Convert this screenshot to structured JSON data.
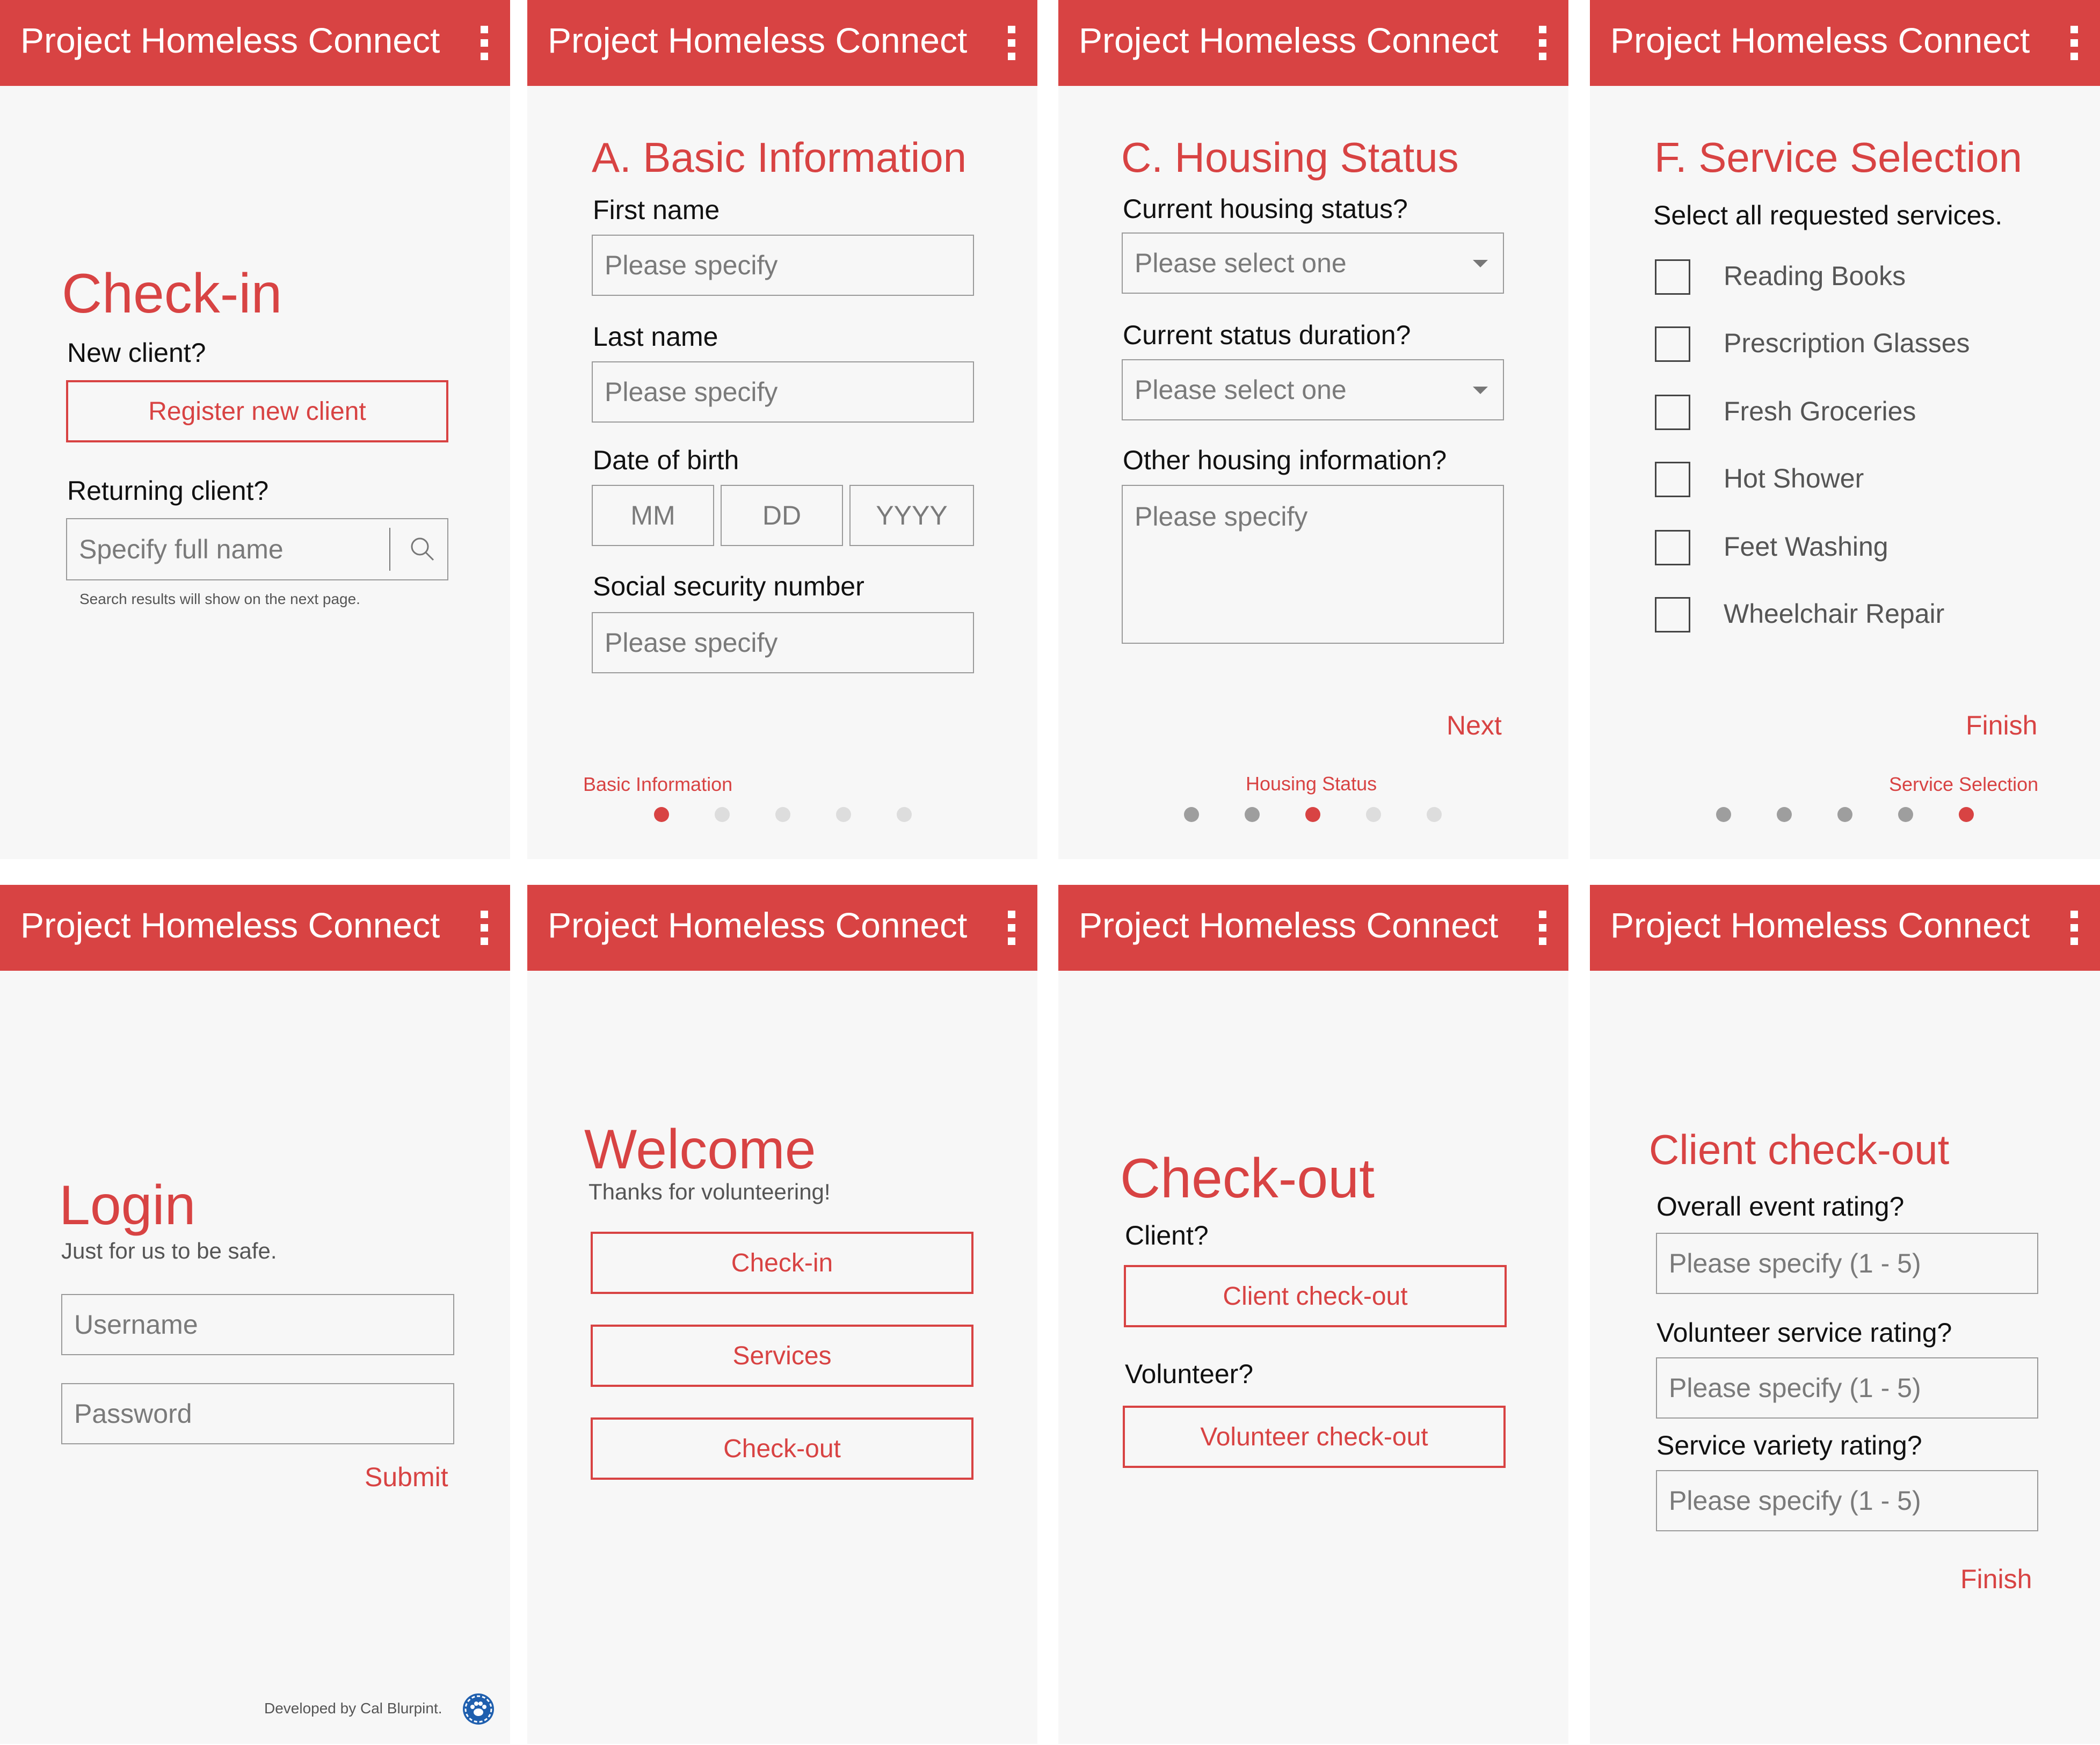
{
  "app_title": "Project Homeless Connect",
  "colors": {
    "brand": "#d84343",
    "background": "#f7f7f7",
    "dot_active": "#d84343",
    "dot_done": "#9e9e9e",
    "dot_todo": "#dddddd"
  },
  "icons": {
    "menu": "kebab-menu-icon",
    "search": "search-icon",
    "logo": "bear-paw-logo-icon"
  },
  "checkin": {
    "title": "Check-in",
    "new_client_label": "New client?",
    "register_button": "Register new client",
    "returning_label": "Returning client?",
    "search_placeholder": "Specify full name",
    "search_hint": "Search results will show on the next page."
  },
  "basic_info": {
    "title": "A. Basic Information",
    "first_name_label": "First name",
    "first_name_placeholder": "Please specify",
    "last_name_label": "Last name",
    "last_name_placeholder": "Please specify",
    "dob_label": "Date of birth",
    "dob_mm": "MM",
    "dob_dd": "DD",
    "dob_yyyy": "YYYY",
    "ssn_label": "Social security number",
    "ssn_placeholder": "Please specify",
    "step_label": "Basic Information",
    "step_active": 1,
    "step_total": 5
  },
  "housing": {
    "title": "C. Housing Status",
    "status_label": "Current housing status?",
    "status_placeholder": "Please select one",
    "duration_label": "Current status duration?",
    "duration_placeholder": "Please select one",
    "other_label": "Other housing information?",
    "other_placeholder": "Please specify",
    "next": "Next",
    "step_label": "Housing Status",
    "step_active": 3,
    "step_total": 5
  },
  "services": {
    "title": "F. Service Selection",
    "instruction": "Select all requested services.",
    "items": [
      "Reading Books",
      "Prescription Glasses",
      "Fresh Groceries",
      "Hot Shower",
      "Feet Washing",
      "Wheelchair Repair"
    ],
    "finish": "Finish",
    "step_label": "Service Selection",
    "step_active": 5,
    "step_total": 5
  },
  "login": {
    "title": "Login",
    "subtitle": "Just for us to be safe.",
    "username_placeholder": "Username",
    "password_placeholder": "Password",
    "submit": "Submit",
    "credit": "Developed by Cal Blurpint."
  },
  "welcome": {
    "title": "Welcome",
    "subtitle": "Thanks for volunteering!",
    "checkin_button": "Check-in",
    "services_button": "Services",
    "checkout_button": "Check-out"
  },
  "checkout": {
    "title": "Check-out",
    "client_label": "Client?",
    "client_button": "Client check-out",
    "volunteer_label": "Volunteer?",
    "volunteer_button": "Volunteer check-out"
  },
  "client_checkout": {
    "title": "Client check-out",
    "overall_label": "Overall event rating?",
    "overall_placeholder": "Please specify (1 - 5)",
    "volunteer_label": "Volunteer service rating?",
    "volunteer_placeholder": "Please specify (1 - 5)",
    "variety_label": "Service variety rating?",
    "variety_placeholder": "Please specify (1 - 5)",
    "finish": "Finish"
  }
}
